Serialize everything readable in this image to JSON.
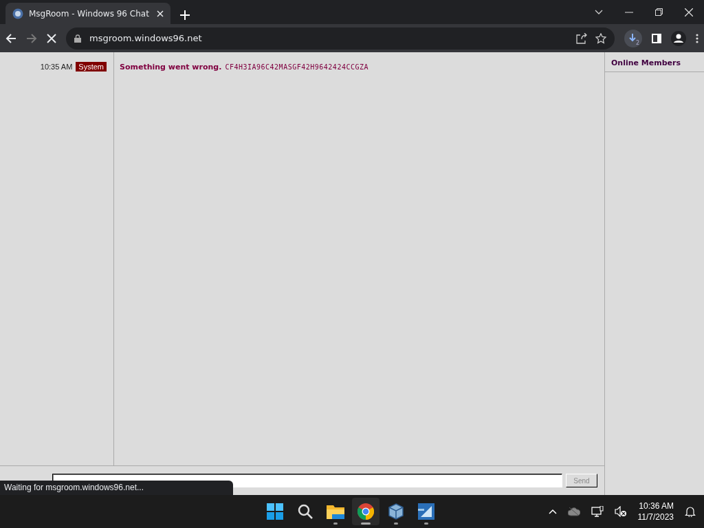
{
  "browser": {
    "tab_title": "MsgRoom - Windows 96 Chat",
    "url": "msgroom.windows96.net",
    "download_count": "2",
    "status": "Waiting for msgroom.windows96.net..."
  },
  "chat": {
    "messages": [
      {
        "time": "10:35 AM",
        "sender": "System",
        "text": "Something went wrong.",
        "code": "CF4H3IA96C42MASGF42H9642424CCGZA"
      }
    ],
    "members_title": "Online Members",
    "send_label": "Send"
  },
  "taskbar": {
    "apps": [
      {
        "kind": "start",
        "selected": false
      },
      {
        "kind": "search",
        "selected": false
      },
      {
        "kind": "folder",
        "selected": false
      },
      {
        "kind": "browser",
        "selected": true
      },
      {
        "kind": "cube",
        "selected": false
      },
      {
        "kind": "xp",
        "selected": false
      }
    ],
    "time": "10:36 AM",
    "date": "11/7/2023"
  }
}
